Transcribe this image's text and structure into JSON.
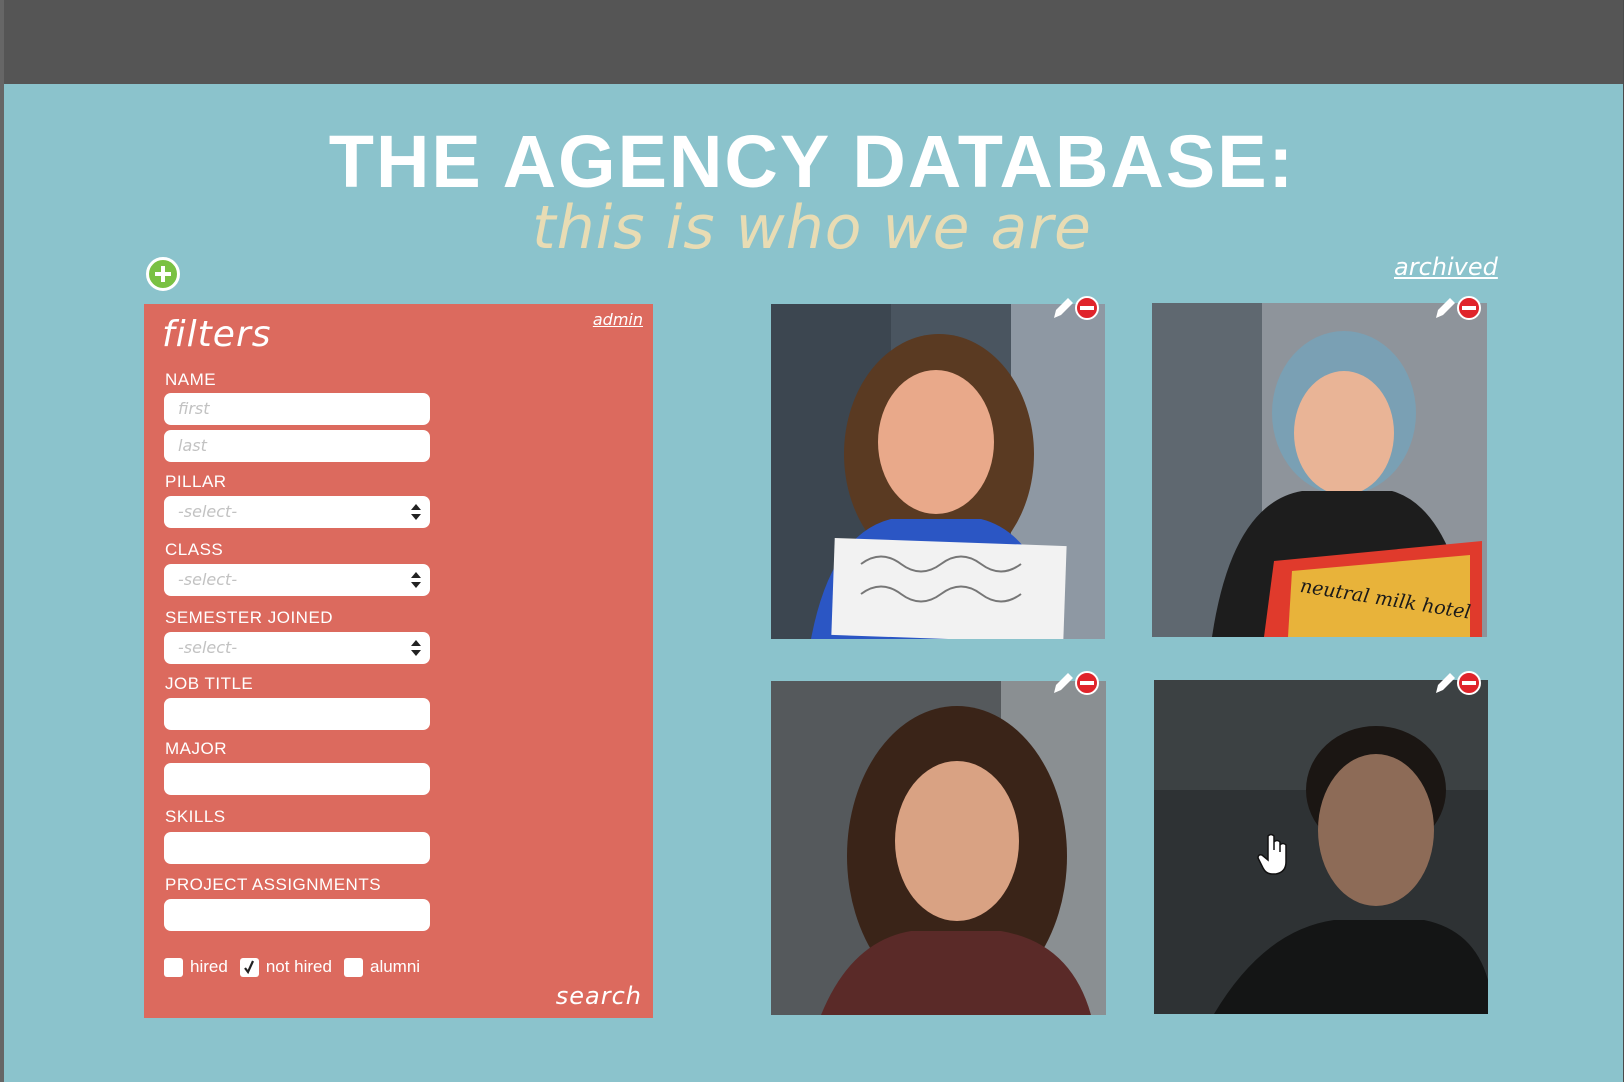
{
  "header": {
    "title": "THE AGENCY DATABASE:",
    "subtitle": "this is who we are",
    "archived_link": "archived"
  },
  "filters": {
    "title": "filters",
    "admin_link": "admin",
    "name_label": "NAME",
    "first_placeholder": "first",
    "last_placeholder": "last",
    "pillar_label": "PILLAR",
    "pillar_value": "-select-",
    "class_label": "CLASS",
    "class_value": "-select-",
    "semester_label": "SEMESTER JOINED",
    "semester_value": "-select-",
    "job_title_label": "JOB TITLE",
    "major_label": "MAJOR",
    "skills_label": "SKILLS",
    "projects_label": "PROJECT ASSIGNMENTS",
    "checkboxes": [
      {
        "label": "hired",
        "checked": false
      },
      {
        "label": "not hired",
        "checked": true
      },
      {
        "label": "alumni",
        "checked": false
      }
    ],
    "search_label": "search"
  },
  "members": [
    {
      "photo": "member-photo-1"
    },
    {
      "photo": "member-photo-2",
      "sign_text": "neutral milk hotel"
    },
    {
      "photo": "member-photo-3"
    },
    {
      "photo": "member-photo-4"
    }
  ],
  "colors": {
    "background": "#8bc3cc",
    "topbar": "#555555",
    "panel": "#dc6a5e",
    "subtitle": "#e8dcb4",
    "add": "#7ac143",
    "delete": "#e0242b"
  }
}
